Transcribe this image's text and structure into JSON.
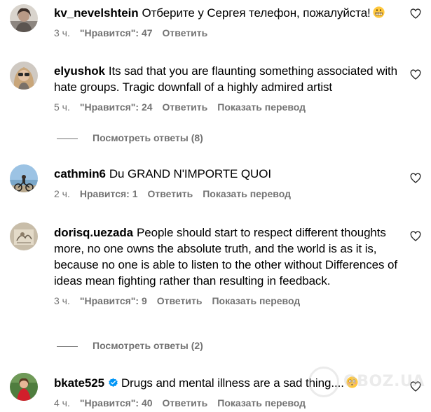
{
  "colors": {
    "meta": "#737373",
    "text": "#000000",
    "verified": "#0095f6",
    "background": "#ffffff"
  },
  "watermark_text": "OBOZ.UA",
  "view_replies": [
    {
      "label": "Посмотреть ответы (8)"
    },
    {
      "label": "Посмотреть ответы (2)"
    }
  ],
  "comments": [
    {
      "username": "kv_nevelshtein",
      "text": "Отберите у Сергея телефон, пожалуйста!",
      "emoji": "grimacing-face-emoji",
      "time": "3 ч.",
      "likes": "\"Нравится\": 47",
      "reply": "Ответить",
      "translate": ""
    },
    {
      "username": "elyushok",
      "text": "Its sad that you are flaunting something associated with hate groups. Tragic downfall of a highly admired artist",
      "time": "5 ч.",
      "likes": "\"Нравится\": 24",
      "reply": "Ответить",
      "translate": "Показать перевод"
    },
    {
      "username": "cathmin6",
      "text": "Du GRAND N'IMPORTE QUOI",
      "time": "2 ч.",
      "likes": "Нравится: 1",
      "reply": "Ответить",
      "translate": "Показать перевод"
    },
    {
      "username": "dorisq.uezada",
      "text": "People should start to respect different thoughts more, no one owns the absolute truth, and the world is as it is, because no one is able to listen to the other without Differences of ideas mean fighting rather than resulting in feedback.",
      "time": "3 ч.",
      "likes": "\"Нравится\": 9",
      "reply": "Ответить",
      "translate": "Показать перевод"
    },
    {
      "username": "bkate525",
      "verified": true,
      "text": "Drugs and mental illness are a sad thing....",
      "emoji": "flushed-face-emoji",
      "time": "4 ч.",
      "likes": "\"Нравится\": 40",
      "reply": "Ответить",
      "translate": "Показать перевод"
    }
  ]
}
